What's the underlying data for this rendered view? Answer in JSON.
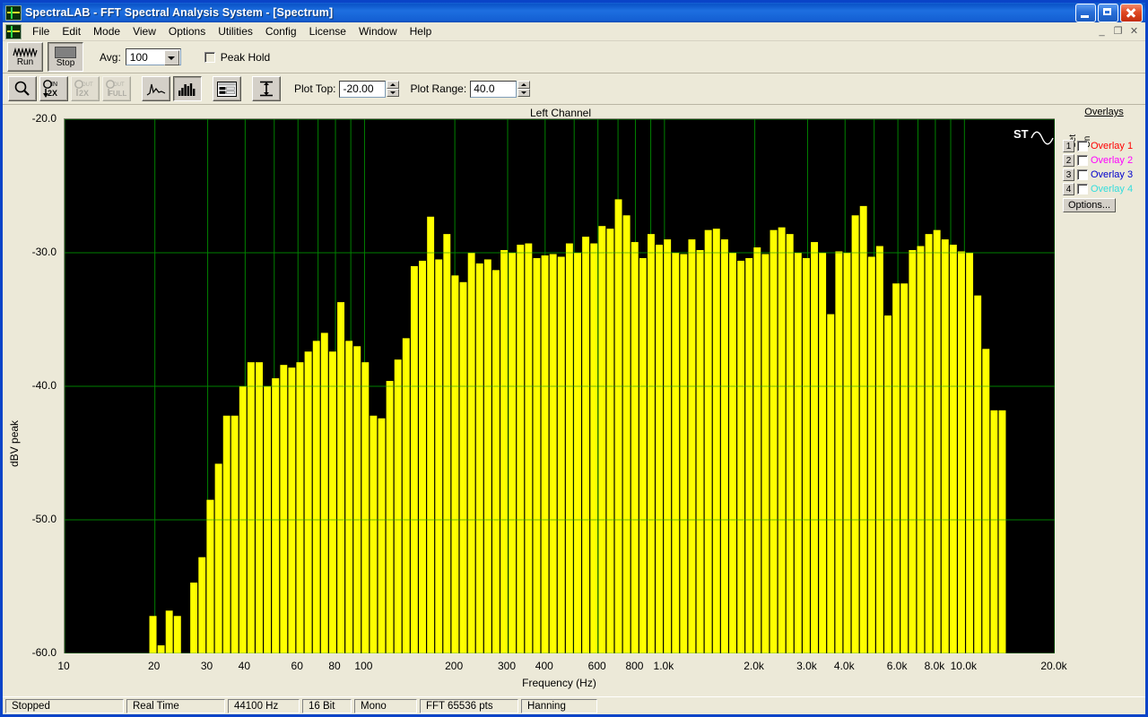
{
  "window": {
    "title": "SpectraLAB - FFT Spectral Analysis System - [Spectrum]",
    "app_icon": "spectralab-icon",
    "minimize_label": "minimize-icon",
    "maximize_label": "maximize-icon",
    "close_label": "close-icon"
  },
  "menu": {
    "items": [
      {
        "label": "File"
      },
      {
        "label": "Edit"
      },
      {
        "label": "Mode"
      },
      {
        "label": "View"
      },
      {
        "label": "Options"
      },
      {
        "label": "Utilities"
      },
      {
        "label": "Config"
      },
      {
        "label": "License"
      },
      {
        "label": "Window"
      },
      {
        "label": "Help"
      }
    ],
    "mdi_minimize": "_",
    "mdi_restore": "❐",
    "mdi_close": "✕"
  },
  "toolbar1": {
    "run_label": "Run",
    "stop_label": "Stop",
    "avg_label": "Avg:",
    "avg_value": "100",
    "peak_hold_label": "Peak Hold",
    "peak_hold_checked": false
  },
  "toolbar2": {
    "icons": [
      {
        "name": "zoom-magnifier-icon",
        "label": "Zoom"
      },
      {
        "name": "zoom-in-2x-icon",
        "label": "IN 2X"
      },
      {
        "name": "zoom-out-2x-icon",
        "label": "OUT 2X"
      },
      {
        "name": "zoom-out-full-icon",
        "label": "OUT FULL"
      },
      {
        "name": "line-plot-icon",
        "label": "Line Plot"
      },
      {
        "name": "bar-plot-icon",
        "label": "Bar Plot"
      },
      {
        "name": "data-table-icon",
        "label": "Data Table"
      },
      {
        "name": "scale-icon",
        "label": "Scale"
      }
    ],
    "plot_top_label": "Plot Top:",
    "plot_top_value": "-20.00",
    "plot_range_label": "Plot Range:",
    "plot_range_value": "40.0"
  },
  "overlays": {
    "title": "Overlays",
    "set_label": "Set",
    "on_label": "On",
    "options_label": "Options...",
    "rows": [
      {
        "num": "1",
        "label": "Overlay 1",
        "color": "#ff0000",
        "checked": false
      },
      {
        "num": "2",
        "label": "Overlay 2",
        "color": "#ff00ff",
        "checked": false
      },
      {
        "num": "3",
        "label": "Overlay 3",
        "color": "#0000cc",
        "checked": false
      },
      {
        "num": "4",
        "label": "Overlay 4",
        "color": "#33dddd",
        "checked": false
      }
    ]
  },
  "plot_markers": {
    "st_label": "ST",
    "sine_icon": "sine-wave-icon"
  },
  "statusbar": {
    "cells": [
      {
        "name": "status-state",
        "text": "Stopped",
        "width": 132
      },
      {
        "name": "status-mode",
        "text": "Real Time",
        "width": 110
      },
      {
        "name": "status-samplerate",
        "text": "44100 Hz",
        "width": 80
      },
      {
        "name": "status-bitdepth",
        "text": "16 Bit",
        "width": 55
      },
      {
        "name": "status-channels",
        "text": "Mono",
        "width": 70
      },
      {
        "name": "status-fftsize",
        "text": "FFT 65536 pts",
        "width": 110
      },
      {
        "name": "status-window",
        "text": "Hanning",
        "width": 85
      }
    ]
  },
  "chart_data": {
    "type": "bar",
    "title": "Left Channel",
    "xlabel": "Frequency (Hz)",
    "ylabel": "dBV peak",
    "xscale": "log",
    "xlim": [
      10,
      20000
    ],
    "ylim": [
      -60.0,
      -20.0
    ],
    "grid": true,
    "bar_color": "#ffff00",
    "grid_color": "#008000",
    "background": "#000000",
    "yticks": [
      -20.0,
      -30.0,
      -40.0,
      -50.0,
      -60.0
    ],
    "ytick_labels": [
      "-20.0",
      "-30.0",
      "-40.0",
      "-50.0",
      "-60.0"
    ],
    "xticks": [
      10,
      20,
      30,
      40,
      60,
      80,
      100,
      200,
      300,
      400,
      600,
      800,
      1000,
      2000,
      3000,
      4000,
      6000,
      8000,
      10000,
      20000
    ],
    "xtick_labels": [
      "10",
      "20",
      "30",
      "40",
      "60",
      "80",
      "100",
      "200",
      "300",
      "400",
      "600",
      "800",
      "1.0k",
      "2.0k",
      "3.0k",
      "4.0k",
      "6.0k",
      "8.0k",
      "10.0k",
      "20.0k"
    ],
    "minor_xticks": [
      50,
      70,
      90,
      500,
      700,
      900,
      5000,
      7000,
      9000
    ],
    "x": [
      10.5,
      11.2,
      11.9,
      12.7,
      13.5,
      14.4,
      15.3,
      16.3,
      17.4,
      18.5,
      19.7,
      21.0,
      22.3,
      23.8,
      25.3,
      27.0,
      28.7,
      30.6,
      32.6,
      34.7,
      36.9,
      39.3,
      41.8,
      44.6,
      47.4,
      50.5,
      53.8,
      57.2,
      60.9,
      64.9,
      69.1,
      73.5,
      78.3,
      83.4,
      88.8,
      94.5,
      100.6,
      107.1,
      114.0,
      121.4,
      129.2,
      137.6,
      146.5,
      156.0,
      166.1,
      176.8,
      188.2,
      200.4,
      213.4,
      227.2,
      241.9,
      257.5,
      274.2,
      291.9,
      310.8,
      330.9,
      352.3,
      375.1,
      399.4,
      425.2,
      452.7,
      482.0,
      513.2,
      546.4,
      581.8,
      619.4,
      659.5,
      702.2,
      747.6,
      796.0,
      847.5,
      902.3,
      960.7,
      1023,
      1089,
      1159,
      1234,
      1314,
      1399,
      1490,
      1586,
      1689,
      1798,
      1914,
      2038,
      2170,
      2310,
      2460,
      2619,
      2788,
      2969,
      3161,
      3365,
      3583,
      3815,
      4062,
      4325,
      4605,
      4903,
      5220,
      5558,
      5918,
      6301,
      6709,
      7143,
      7605,
      8097,
      8621,
      9179,
      9773,
      10405,
      11078,
      11795,
      12558,
      13370,
      14235,
      15156,
      16136,
      17180,
      18291,
      19474
    ],
    "values": [
      -60.0,
      -60.0,
      -60.0,
      -60.0,
      -60.0,
      -60.0,
      -60.0,
      -60.0,
      -60.0,
      -60.0,
      -57.2,
      -59.4,
      -56.8,
      -57.2,
      -60.0,
      -54.7,
      -52.8,
      -48.5,
      -45.8,
      -42.2,
      -42.2,
      -40.0,
      -38.2,
      -38.2,
      -40.0,
      -39.4,
      -38.4,
      -38.6,
      -38.2,
      -37.4,
      -36.6,
      -36.0,
      -37.4,
      -33.7,
      -36.6,
      -37.0,
      -38.2,
      -42.2,
      -42.4,
      -39.6,
      -38.0,
      -36.4,
      -31.0,
      -30.6,
      -27.3,
      -30.5,
      -28.6,
      -31.7,
      -32.2,
      -30.0,
      -30.8,
      -30.5,
      -31.3,
      -29.8,
      -30.0,
      -29.4,
      -29.3,
      -30.4,
      -30.2,
      -30.1,
      -30.3,
      -29.3,
      -30.0,
      -28.8,
      -29.3,
      -28.0,
      -28.2,
      -26.0,
      -27.2,
      -29.2,
      -30.4,
      -28.6,
      -29.4,
      -29.0,
      -30.0,
      -30.1,
      -29.0,
      -29.8,
      -28.3,
      -28.2,
      -29.0,
      -30.0,
      -30.6,
      -30.4,
      -29.6,
      -30.1,
      -28.3,
      -28.1,
      -28.6,
      -30.0,
      -30.4,
      -29.2,
      -30.0,
      -34.6,
      -29.9,
      -30.0,
      -27.2,
      -26.5,
      -30.3,
      -29.5,
      -34.7,
      -32.3,
      -32.3,
      -29.8,
      -29.5,
      -28.6,
      -28.3,
      -29.0,
      -29.4,
      -29.9,
      -30.0,
      -33.2,
      -37.2,
      -41.8,
      -41.8
    ]
  }
}
